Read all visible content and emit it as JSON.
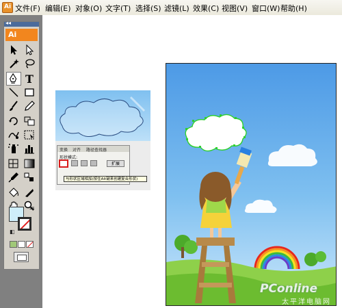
{
  "menu": {
    "items": [
      "文件(F)",
      "编辑(E)",
      "对象(O)",
      "文字(T)",
      "选择(S)",
      "滤镜(L)",
      "效果(C)",
      "视图(V)",
      "窗口(W)",
      "帮助(H)"
    ]
  },
  "toolbox": {
    "collapse": "◂◂",
    "logo": "Ai",
    "tools": [
      "selection-tool",
      "direct-selection-tool",
      "magic-wand-tool",
      "lasso-tool",
      "pen-tool",
      "type-tool",
      "line-tool",
      "rectangle-tool",
      "paintbrush-tool",
      "pencil-tool",
      "rotate-tool",
      "scale-tool",
      "warp-tool",
      "free-transform-tool",
      "symbol-sprayer-tool",
      "column-graph-tool",
      "mesh-tool",
      "gradient-tool",
      "eyedropper-tool",
      "blend-tool",
      "live-paint-bucket-tool",
      "live-paint-selection-tool",
      "slice-tool",
      "eraser-tool",
      "hand-tool",
      "zoom-tool"
    ],
    "fill_color": "#cfeefa",
    "stroke": "none"
  },
  "thumbnail": {
    "tabs": [
      "变换",
      "对齐",
      "路径查找器"
    ],
    "shape_modes_label": "形状模式:",
    "expand_button": "扩展",
    "tooltip": "与形状区域相加(按住Alt键来创建复合形状)"
  },
  "watermark": {
    "brand": "PConline",
    "subtitle": "太平洋电脑网"
  }
}
